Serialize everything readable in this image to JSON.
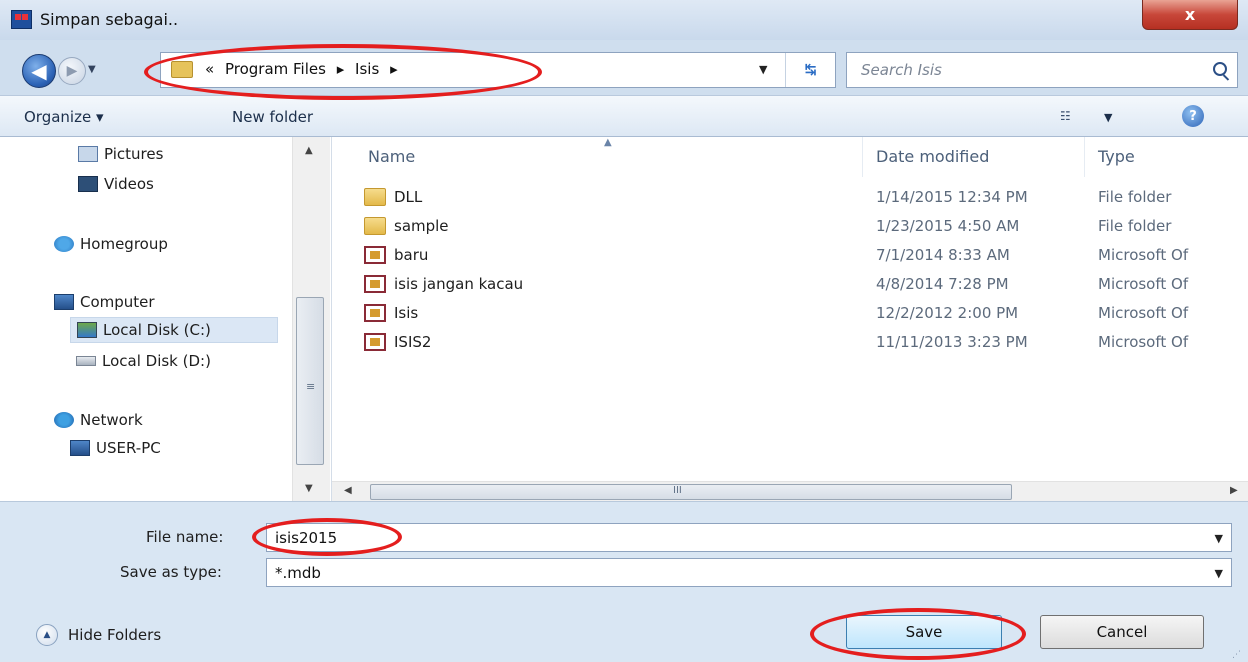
{
  "window": {
    "title": "Simpan sebagai..",
    "close_label": "x"
  },
  "address_bar": {
    "prefix": "«",
    "segments": [
      "Program Files",
      "Isis"
    ],
    "separator": "▸"
  },
  "search": {
    "placeholder": "Search Isis"
  },
  "toolbar": {
    "organize_label": "Organize ▾",
    "new_folder_label": "New folder",
    "help_label": "?"
  },
  "nav_pane": {
    "items": [
      {
        "label": "Pictures",
        "icon": "pictures-icon"
      },
      {
        "label": "Videos",
        "icon": "videos-icon"
      },
      {
        "label": "Homegroup",
        "icon": "homegroup-icon"
      },
      {
        "label": "Computer",
        "icon": "computer-icon"
      },
      {
        "label": "Local Disk (C:)",
        "icon": "disk-c-icon",
        "selected": true
      },
      {
        "label": "Local Disk (D:)",
        "icon": "disk-icon"
      },
      {
        "label": "Network",
        "icon": "network-icon"
      },
      {
        "label": "USER-PC",
        "icon": "pc-icon"
      }
    ]
  },
  "file_list": {
    "columns": [
      "Name",
      "Date modified",
      "Type"
    ],
    "rows": [
      {
        "name": "DLL",
        "date": "1/14/2015 12:34 PM",
        "type": "File folder",
        "icon": "folder-icon"
      },
      {
        "name": "sample",
        "date": "1/23/2015 4:50 AM",
        "type": "File folder",
        "icon": "folder-icon"
      },
      {
        "name": "baru",
        "date": "7/1/2014 8:33 AM",
        "type": "Microsoft Of",
        "icon": "access-file-icon"
      },
      {
        "name": "isis jangan kacau",
        "date": "4/8/2014 7:28 PM",
        "type": "Microsoft Of",
        "icon": "access-file-icon"
      },
      {
        "name": "Isis",
        "date": "12/2/2012 2:00 PM",
        "type": "Microsoft Of",
        "icon": "access-file-icon"
      },
      {
        "name": "ISIS2",
        "date": "11/11/2013 3:23 PM",
        "type": "Microsoft Of",
        "icon": "access-file-icon"
      }
    ],
    "hscroll_grip": "III"
  },
  "form": {
    "file_name_label": "File name:",
    "file_name_value": "isis2015",
    "save_type_label": "Save as type:",
    "save_type_value": "*.mdb"
  },
  "footer": {
    "hide_folders_label": "Hide Folders",
    "save_label": "Save",
    "cancel_label": "Cancel"
  },
  "colors": {
    "annotation": "#e41e1e",
    "titlebar": "#c9d9ec",
    "close_button": "#c8473a"
  }
}
